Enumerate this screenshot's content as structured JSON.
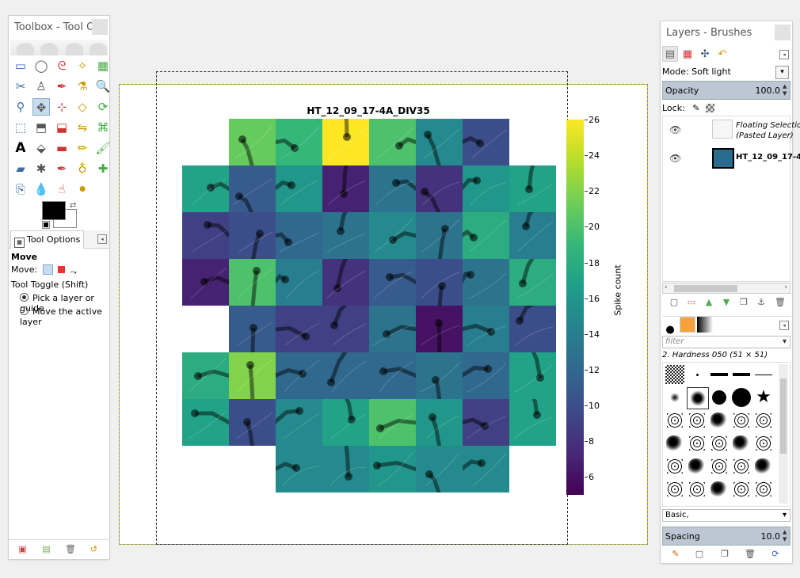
{
  "toolbox": {
    "title": "Toolbox - Tool O...",
    "tools": [
      "rect-select-icon",
      "ellipse-select-icon",
      "free-select-icon",
      "fuzzy-select-icon",
      "select-by-color-icon",
      "scissors-icon",
      "foreground-select-icon",
      "paths-icon",
      "color-picker-icon",
      "zoom-icon",
      "measure-icon",
      "move-icon",
      "align-icon",
      "transform-icon",
      "rotate-icon",
      "scale-icon",
      "shear-icon",
      "perspective-icon",
      "flip-icon",
      "cage-icon",
      "text-icon",
      "bucket-fill-icon",
      "gradient-icon",
      "pencil-icon",
      "paintbrush-icon",
      "eraser-icon",
      "airbrush-icon",
      "ink-icon",
      "clone-icon",
      "heal-icon",
      "perspective-clone-icon",
      "blur-icon",
      "smudge-icon",
      "dodge-burn-icon"
    ],
    "tab_label": "Tool Options",
    "option_title": "Move",
    "move_label": "Move:",
    "toggle_label": "Tool Toggle  (Shift)",
    "radio_pick": "Pick a layer or guide",
    "radio_move": "Move the active layer",
    "fg_color": "#000000",
    "bg_color": "#ffffff"
  },
  "canvas": {
    "figure_title": "HT_12_09_17-4A_DIV35",
    "colorbar_label": "Spike count"
  },
  "chart_data": {
    "type": "heatmap",
    "title": "HT_12_09_17-4A_DIV35",
    "colorbar": {
      "label": "Spike count",
      "range": [
        5,
        26
      ],
      "ticks": [
        6,
        8,
        10,
        12,
        14,
        16,
        18,
        20,
        22,
        24,
        26
      ]
    },
    "rows": [
      [
        null,
        21,
        19,
        26,
        20,
        15,
        10,
        null
      ],
      [
        17,
        11,
        16,
        7,
        13,
        8,
        16,
        17
      ],
      [
        9,
        10,
        12,
        13,
        15,
        13,
        18,
        14
      ],
      [
        7,
        20,
        14,
        8,
        11,
        10,
        13,
        18
      ],
      [
        null,
        11,
        9,
        9,
        13,
        6,
        14,
        10
      ],
      [
        18,
        22,
        12,
        12,
        12,
        13,
        12,
        17
      ],
      [
        17,
        10,
        15,
        17,
        20,
        16,
        9,
        17
      ],
      [
        null,
        null,
        15,
        15,
        16,
        15,
        15,
        null
      ]
    ],
    "colors": {
      "low": "#440154",
      "mid": "#21918c",
      "high": "#fde725"
    }
  },
  "layers": {
    "title": "Layers - Brushes",
    "mode_label": "Mode: Soft light",
    "opacity_label": "Opacity",
    "opacity_value": "100.0",
    "lock_label": "Lock:",
    "items": [
      {
        "name_line1": "Floating Selectio",
        "name_line2": "(Pasted Layer)"
      },
      {
        "name_line1": "HT_12_09_17-4"
      }
    ],
    "filter_placeholder": "filter",
    "brush_name": "2. Hardness 050 (51 × 51)",
    "preset": "Basic,",
    "spacing_label": "Spacing",
    "spacing_value": "10.0"
  }
}
